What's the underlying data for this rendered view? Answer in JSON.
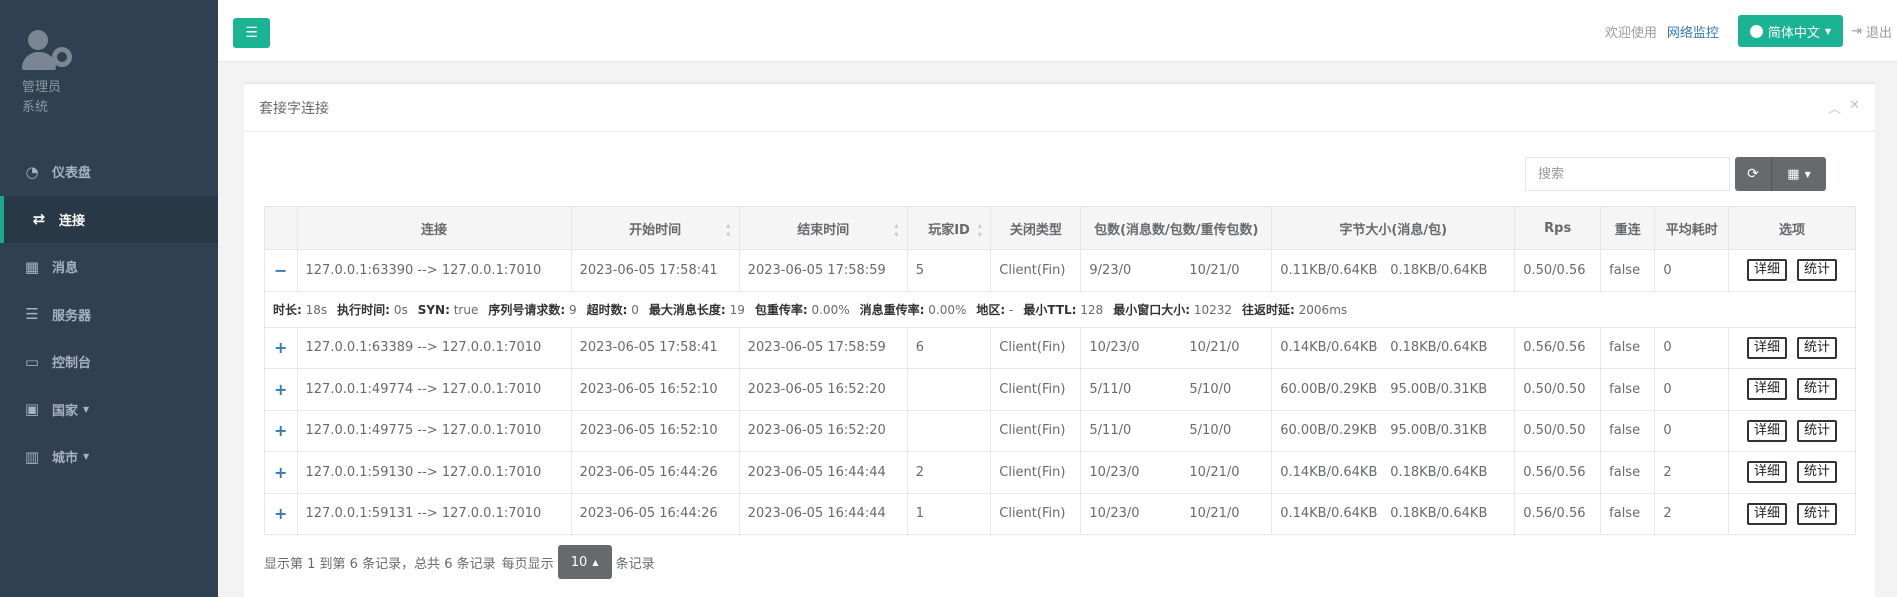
{
  "sidebar": {
    "user_name": "管理员",
    "user_role": "系统",
    "items": [
      {
        "label": "仪表盘",
        "icon": "dashboard-icon",
        "glyph": "◔",
        "active": false,
        "caret": false
      },
      {
        "label": "连接",
        "icon": "exchange-icon",
        "glyph": "⇄",
        "active": true,
        "caret": false
      },
      {
        "label": "消息",
        "icon": "table-icon",
        "glyph": "▦",
        "active": false,
        "caret": false
      },
      {
        "label": "服务器",
        "icon": "server-icon",
        "glyph": "☰",
        "active": false,
        "caret": false
      },
      {
        "label": "控制台",
        "icon": "desktop-icon",
        "glyph": "▭",
        "active": false,
        "caret": false
      },
      {
        "label": "国家",
        "icon": "bus-icon",
        "glyph": "▣",
        "active": false,
        "caret": true
      },
      {
        "label": "城市",
        "icon": "building-icon",
        "glyph": "▥",
        "active": false,
        "caret": true
      }
    ]
  },
  "topbar": {
    "welcome": "欢迎使用",
    "netmon": "网络监控",
    "language": "简体中文",
    "logout": "退出"
  },
  "panel": {
    "title": "套接字连接",
    "search_placeholder": "搜索"
  },
  "table": {
    "headers": [
      "连接",
      "开始时间",
      "结束时间",
      "玩家ID",
      "关闭类型",
      "包数(消息数/包数/重传包数)",
      "字节大小(消息/包)",
      "Rps",
      "重连",
      "平均耗时",
      "选项"
    ],
    "detail_label": "详细",
    "stats_label": "统计",
    "rows": [
      {
        "expand": "−",
        "conn": "127.0.0.1:63390 --> 127.0.0.1:7010",
        "start": "2023-06-05 17:58:41",
        "end": "2023-06-05 17:58:59",
        "player": "5",
        "close": "Client(Fin)",
        "pk1": "9/23/0",
        "pk2": "10/21/0",
        "sz1": "0.11KB/0.64KB",
        "sz2": "0.18KB/0.64KB",
        "rps": "0.50/0.56",
        "reconn": "false",
        "avg": "0"
      },
      {
        "expand": "+",
        "conn": "127.0.0.1:63389 --> 127.0.0.1:7010",
        "start": "2023-06-05 17:58:41",
        "end": "2023-06-05 17:58:59",
        "player": "6",
        "close": "Client(Fin)",
        "pk1": "10/23/0",
        "pk2": "10/21/0",
        "sz1": "0.14KB/0.64KB",
        "sz2": "0.18KB/0.64KB",
        "rps": "0.56/0.56",
        "reconn": "false",
        "avg": "0"
      },
      {
        "expand": "+",
        "conn": "127.0.0.1:49774 --> 127.0.0.1:7010",
        "start": "2023-06-05 16:52:10",
        "end": "2023-06-05 16:52:20",
        "player": "",
        "close": "Client(Fin)",
        "pk1": "5/11/0",
        "pk2": "5/10/0",
        "sz1": "60.00B/0.29KB",
        "sz2": "95.00B/0.31KB",
        "rps": "0.50/0.50",
        "reconn": "false",
        "avg": "0"
      },
      {
        "expand": "+",
        "conn": "127.0.0.1:49775 --> 127.0.0.1:7010",
        "start": "2023-06-05 16:52:10",
        "end": "2023-06-05 16:52:20",
        "player": "",
        "close": "Client(Fin)",
        "pk1": "5/11/0",
        "pk2": "5/10/0",
        "sz1": "60.00B/0.29KB",
        "sz2": "95.00B/0.31KB",
        "rps": "0.50/0.50",
        "reconn": "false",
        "avg": "0"
      },
      {
        "expand": "+",
        "conn": "127.0.0.1:59130 --> 127.0.0.1:7010",
        "start": "2023-06-05 16:44:26",
        "end": "2023-06-05 16:44:44",
        "player": "2",
        "close": "Client(Fin)",
        "pk1": "10/23/0",
        "pk2": "10/21/0",
        "sz1": "0.14KB/0.64KB",
        "sz2": "0.18KB/0.64KB",
        "rps": "0.56/0.56",
        "reconn": "false",
        "avg": "2"
      },
      {
        "expand": "+",
        "conn": "127.0.0.1:59131 --> 127.0.0.1:7010",
        "start": "2023-06-05 16:44:26",
        "end": "2023-06-05 16:44:44",
        "player": "1",
        "close": "Client(Fin)",
        "pk1": "10/23/0",
        "pk2": "10/21/0",
        "sz1": "0.14KB/0.64KB",
        "sz2": "0.18KB/0.64KB",
        "rps": "0.56/0.56",
        "reconn": "false",
        "avg": "2"
      }
    ],
    "detail": [
      {
        "k": "时长:",
        "v": "18s"
      },
      {
        "k": "执行时间:",
        "v": "0s"
      },
      {
        "k": "SYN:",
        "v": "true"
      },
      {
        "k": "序列号请求数:",
        "v": "9"
      },
      {
        "k": "超时数:",
        "v": "0"
      },
      {
        "k": "最大消息长度:",
        "v": "19"
      },
      {
        "k": "包重传率:",
        "v": "0.00%"
      },
      {
        "k": "消息重传率:",
        "v": "0.00%"
      },
      {
        "k": "地区:",
        "v": "-"
      },
      {
        "k": "最小TTL:",
        "v": "128"
      },
      {
        "k": "最小窗口大小:",
        "v": "10232"
      },
      {
        "k": "往返时延:",
        "v": "2006ms"
      }
    ]
  },
  "footer": {
    "summary": "显示第 1 到第 6 条记录，总共 6 条记录",
    "per_page_prefix": "每页显示",
    "page_size": "10",
    "per_page_suffix": "条记录"
  }
}
